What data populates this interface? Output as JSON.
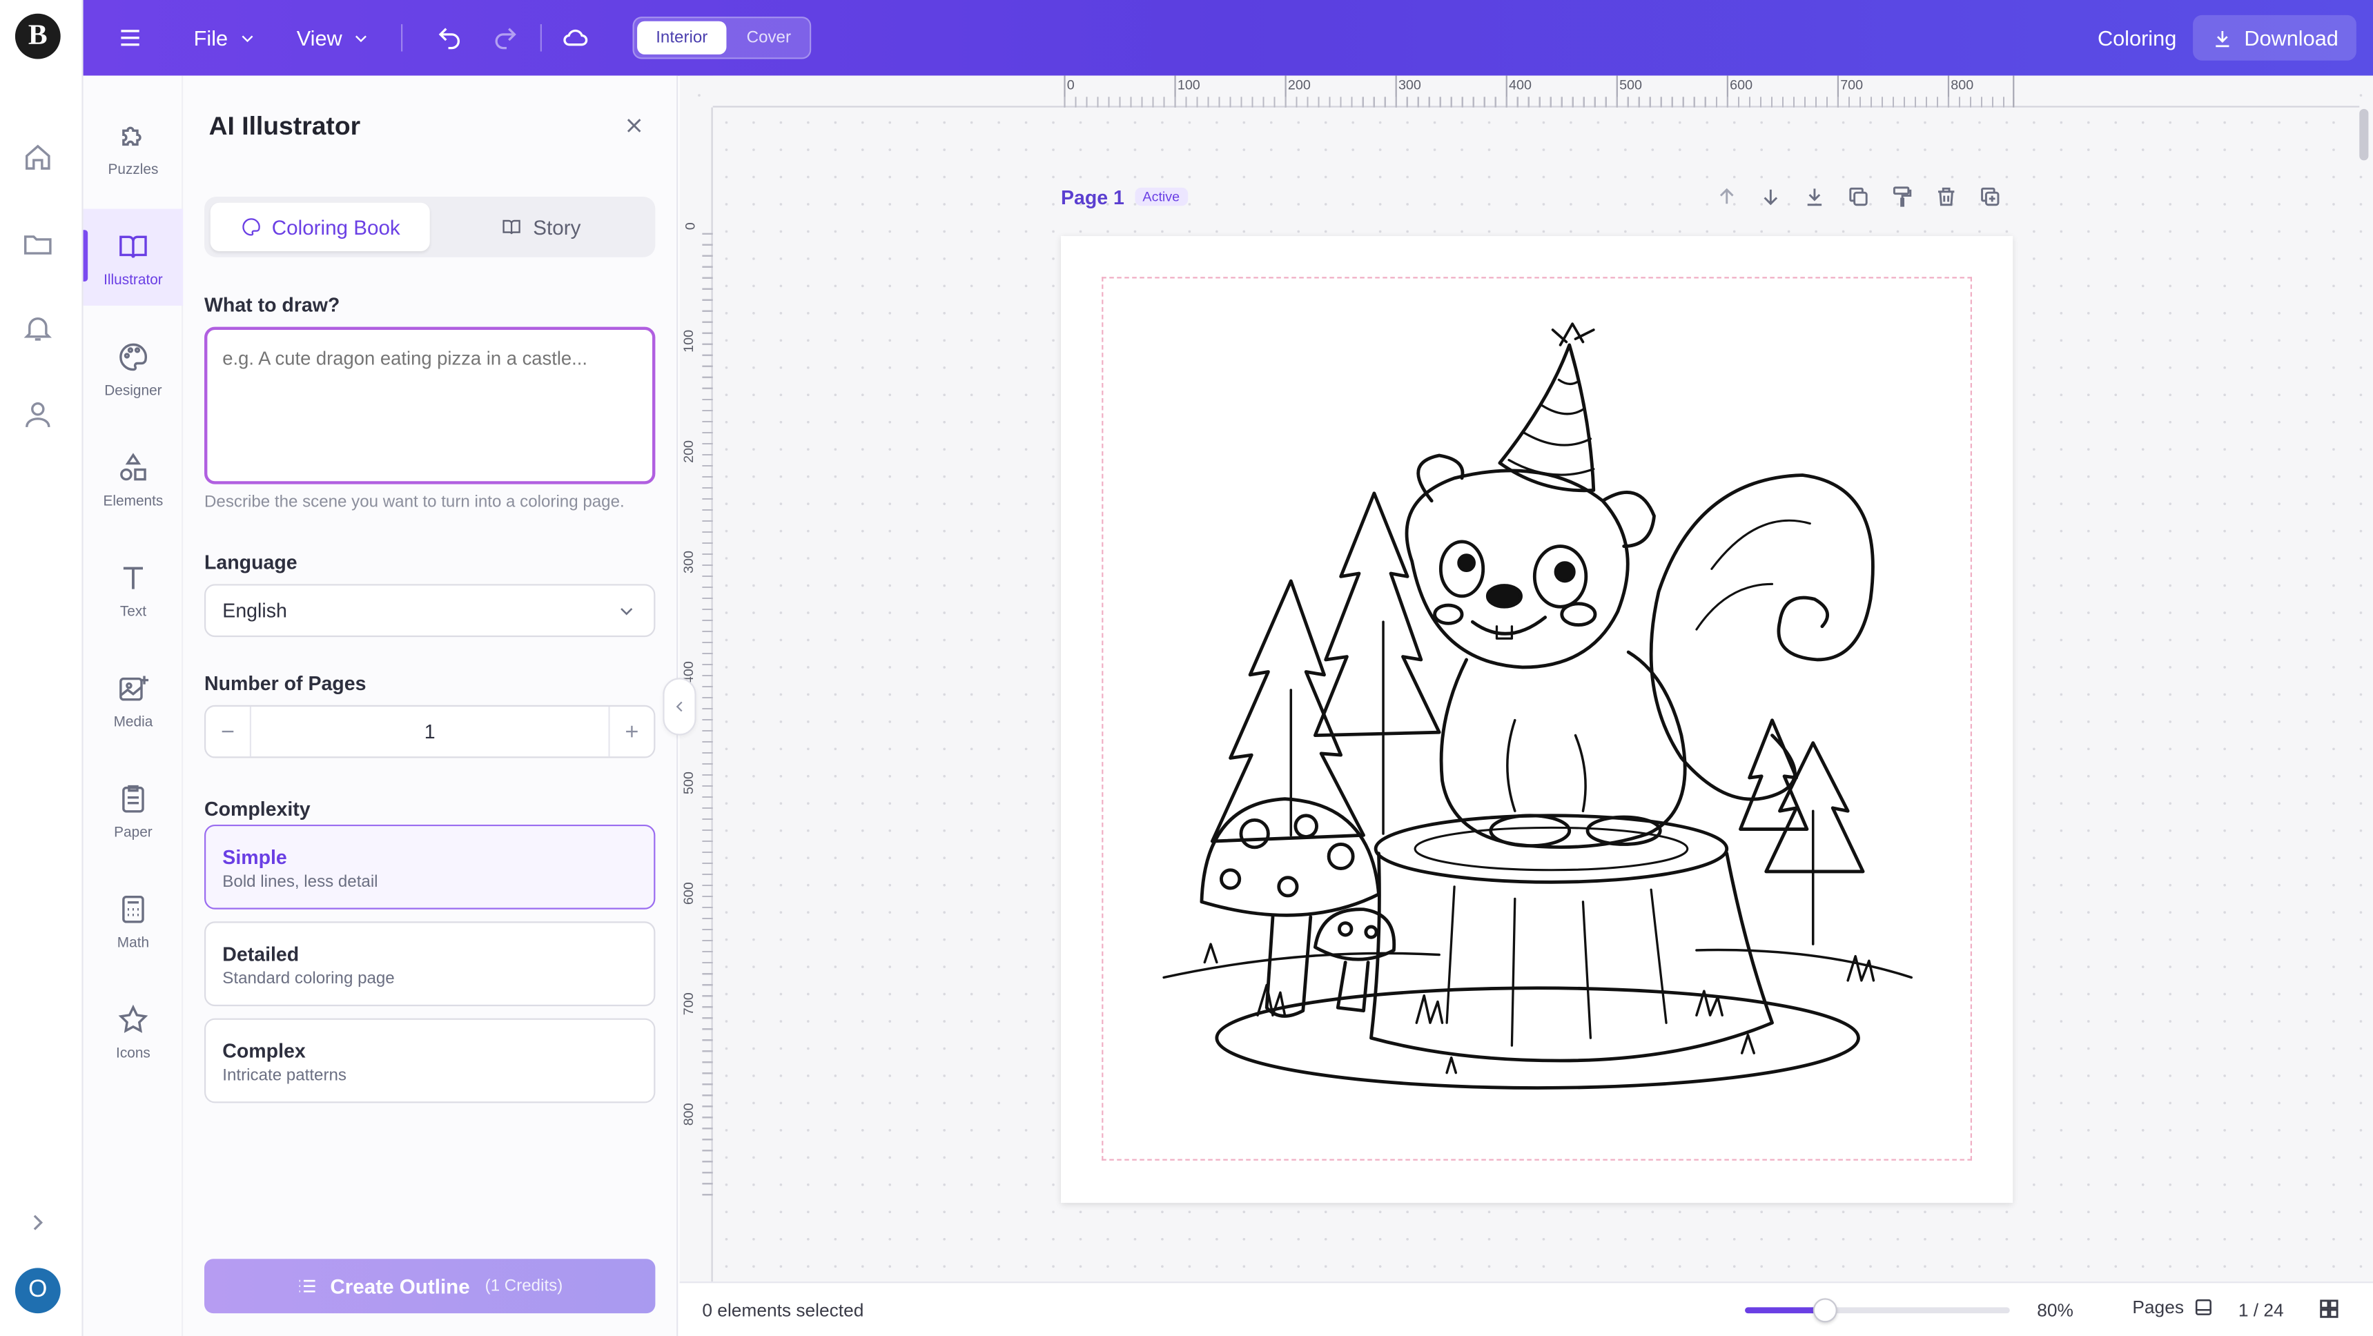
{
  "header": {
    "file_label": "File",
    "view_label": "View",
    "mode_tabs": [
      "Interior",
      "Cover"
    ],
    "right_label": "Coloring",
    "download_label": "Download"
  },
  "rail": {
    "logo_letter": "B",
    "avatar_letter": "O",
    "icons": [
      "home-icon",
      "folder-icon",
      "bell-icon",
      "user-icon",
      "chevron-right-icon"
    ]
  },
  "tools": [
    {
      "label": "Puzzles",
      "icon": "puzzle-icon"
    },
    {
      "label": "Illustrator",
      "icon": "book-icon"
    },
    {
      "label": "Designer",
      "icon": "palette-icon"
    },
    {
      "label": "Elements",
      "icon": "shapes-icon"
    },
    {
      "label": "Text",
      "icon": "text-icon"
    },
    {
      "label": "Media",
      "icon": "image-icon"
    },
    {
      "label": "Paper",
      "icon": "clipboard-icon"
    },
    {
      "label": "Math",
      "icon": "calculator-icon"
    },
    {
      "label": "Icons",
      "icon": "star-icon"
    }
  ],
  "panel": {
    "title": "AI Illustrator",
    "tabs": [
      "Coloring Book",
      "Story"
    ],
    "prompt_label": "What to draw?",
    "prompt_placeholder": "e.g. A cute dragon eating pizza in a castle...",
    "prompt_help": "Describe the scene you want to turn into a coloring page.",
    "language_label": "Language",
    "language_value": "English",
    "pages_label": "Number of Pages",
    "pages_value": "1",
    "complexity_label": "Complexity",
    "complexity_options": [
      {
        "title": "Simple",
        "desc": "Bold lines, less detail"
      },
      {
        "title": "Detailed",
        "desc": "Standard coloring page"
      },
      {
        "title": "Complex",
        "desc": "Intricate patterns"
      }
    ],
    "create_label": "Create Outline",
    "create_credits": "(1 Credits)"
  },
  "canvas": {
    "page_label": "Page 1",
    "page_badge": "Active",
    "ruler_top": [
      "0",
      "100",
      "200",
      "300",
      "400",
      "500",
      "600",
      "700",
      "800"
    ],
    "ruler_left": [
      "0",
      "100",
      "200",
      "300",
      "400",
      "500",
      "600",
      "700",
      "800"
    ]
  },
  "status": {
    "selection": "0 elements selected",
    "zoom": "80%",
    "zoom_fraction": 0.3,
    "pages_label": "Pages",
    "page_count": "1 / 24"
  },
  "colors": {
    "accent": "#6a3fe4",
    "header_start": "#6e43e8",
    "header_end": "#5a4ee6"
  }
}
